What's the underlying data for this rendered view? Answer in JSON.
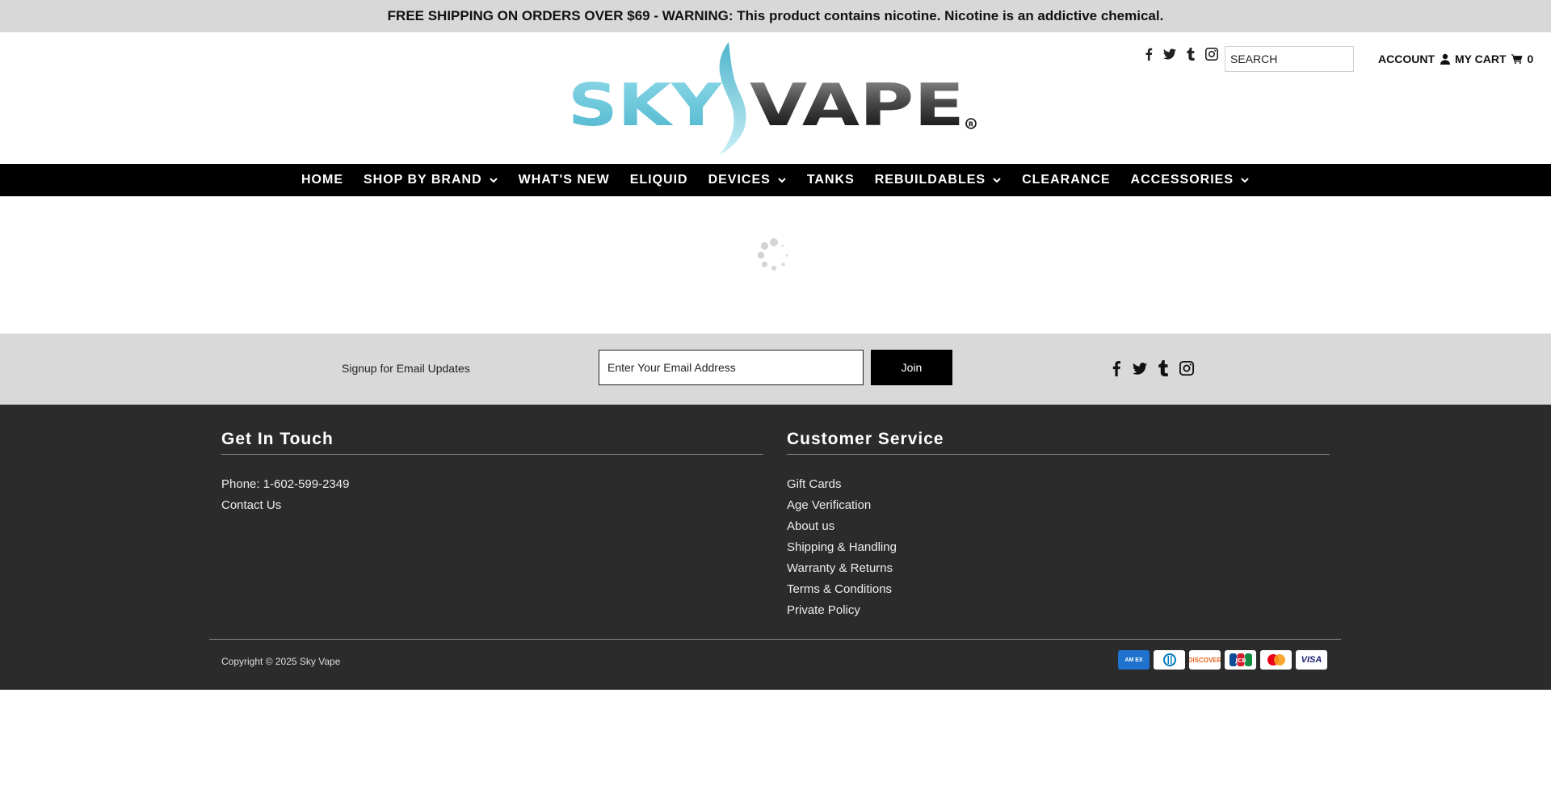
{
  "announcement": "FREE SHIPPING ON ORDERS OVER $69 - WARNING: This product contains nicotine. Nicotine is an addictive chemical.",
  "header": {
    "logo_alt": "SKY VAPE",
    "logo_left": "SKY",
    "logo_right": "VAPE",
    "social_icons": [
      "facebook-icon",
      "twitter-icon",
      "tumblr-icon",
      "instagram-icon"
    ],
    "search_placeholder": "SEARCH",
    "account_label": "ACCOUNT",
    "cart_label": "MY CART",
    "cart_count": "0"
  },
  "nav": [
    {
      "label": "HOME",
      "dropdown": false
    },
    {
      "label": "SHOP BY BRAND",
      "dropdown": true
    },
    {
      "label": "WHAT'S NEW",
      "dropdown": false
    },
    {
      "label": "ELIQUID",
      "dropdown": false
    },
    {
      "label": "DEVICES",
      "dropdown": true
    },
    {
      "label": "TANKS",
      "dropdown": false
    },
    {
      "label": "REBUILDABLES",
      "dropdown": true
    },
    {
      "label": "CLEARANCE",
      "dropdown": false
    },
    {
      "label": "ACCESSORIES",
      "dropdown": true
    }
  ],
  "signup": {
    "label": "Signup for Email Updates",
    "email_placeholder": "Enter Your Email Address",
    "join_label": "Join"
  },
  "footer": {
    "contact": {
      "heading": "Get In Touch",
      "items": [
        "Phone: 1-602-599-2349",
        "Contact Us"
      ]
    },
    "service": {
      "heading": "Customer Service",
      "items": [
        "Gift Cards",
        "Age Verification",
        "About us",
        "Shipping & Handling",
        "Warranty & Returns",
        "Terms & Conditions",
        "Private Policy"
      ]
    },
    "copyright": "Copyright © 2025 Sky Vape",
    "payment_cards": [
      "American Express",
      "Diners Club",
      "Discover",
      "JCB",
      "Mastercard",
      "Visa"
    ],
    "amex_text": "AM EX",
    "discover_text": "DISCOVER",
    "jcb_text": "JCB",
    "visa_text": "VISA"
  },
  "colors": {
    "announcement_bg": "#d8d8d8",
    "nav_bg": "#000000",
    "signup_bg": "#d9d9d9",
    "footer_bg": "#2b2b2b",
    "logo_blue": "#5cc3d8",
    "logo_dark": "#2b2b2b"
  }
}
